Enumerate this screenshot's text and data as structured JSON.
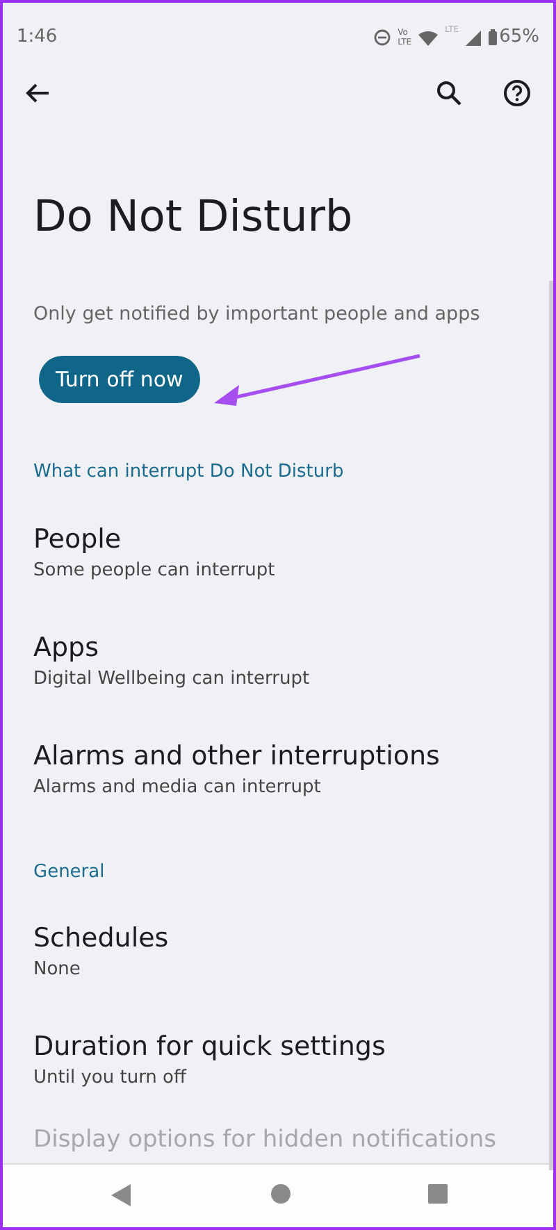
{
  "status_bar": {
    "time": "1:46",
    "volte": [
      "Vo",
      "LTE"
    ],
    "network": "LTE",
    "battery": "65%"
  },
  "title": "Do Not Disturb",
  "description": "Only get notified by important people and apps",
  "action_button": "Turn off now",
  "sections": [
    {
      "header": "What can interrupt Do Not Disturb",
      "items": [
        {
          "title": "People",
          "subtitle": "Some people can interrupt"
        },
        {
          "title": "Apps",
          "subtitle": "Digital Wellbeing can interrupt"
        },
        {
          "title": "Alarms and other interruptions",
          "subtitle": "Alarms and media can interrupt"
        }
      ]
    },
    {
      "header": "General",
      "items": [
        {
          "title": "Schedules",
          "subtitle": "None"
        },
        {
          "title": "Duration for quick settings",
          "subtitle": "Until you turn off"
        }
      ]
    }
  ],
  "hidden_item": "Display options for hidden notifications"
}
